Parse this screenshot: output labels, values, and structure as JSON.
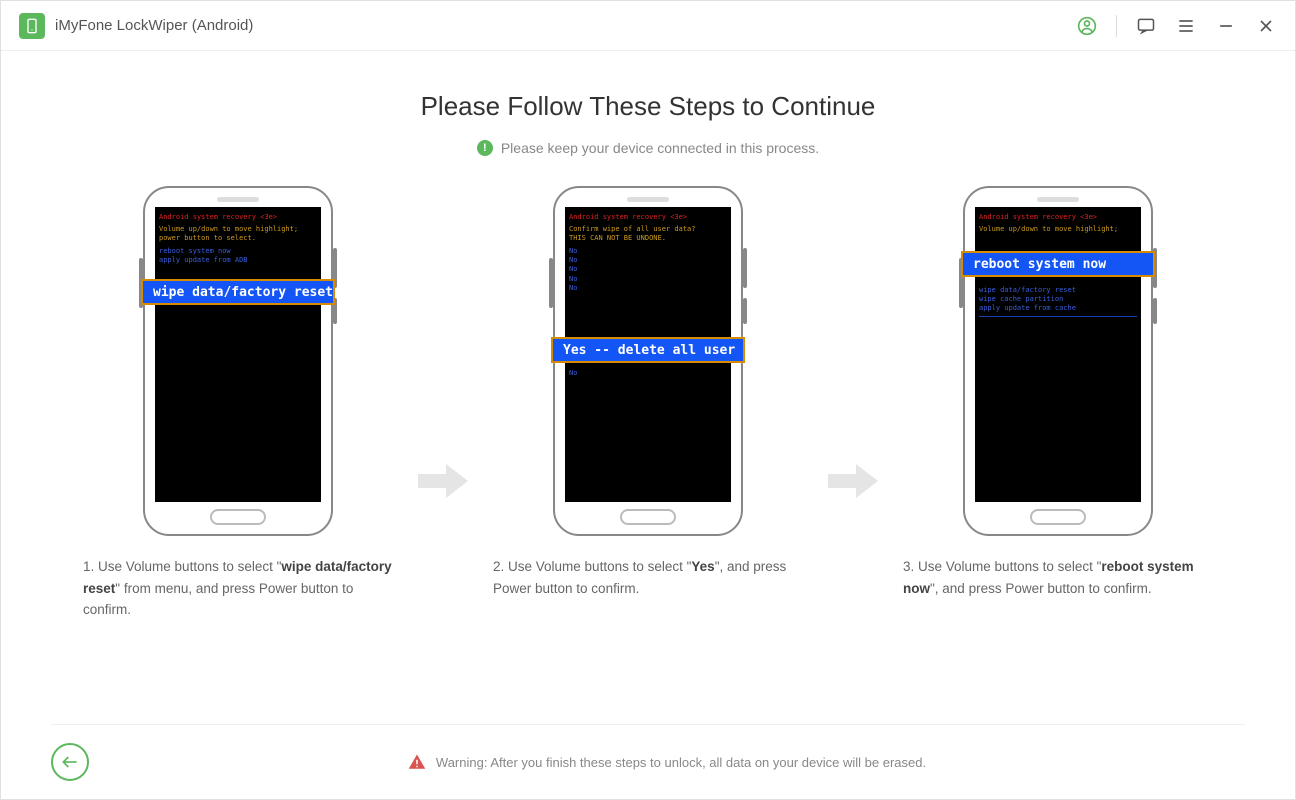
{
  "titlebar": {
    "title": "iMyFone LockWiper (Android)"
  },
  "main": {
    "title": "Please Follow These Steps to Continue",
    "subtitle": "Please keep your device connected in this process."
  },
  "steps": [
    {
      "highlight": "wipe data/factory reset",
      "text_pre": "1. Use Volume buttons to select \"",
      "text_bold": "wipe data/factory reset",
      "text_post": "\" from menu, and press Power button to confirm.",
      "rec_header": "Android system recovery <3e>",
      "rec_yellow": "Volume up/down to move highlight;\npower button to select.",
      "rec_blue": "reboot system now\napply update from ADB"
    },
    {
      "highlight": "Yes -- delete all user",
      "text_pre": "2. Use Volume buttons to select \"",
      "text_bold": "Yes",
      "text_post": "\", and press Power button to confirm.",
      "rec_header": "Android system recovery <3e>",
      "rec_yellow": "Confirm wipe of all user data?\n  THIS CAN NOT BE UNDONE.",
      "rec_blue": "No\nNo\nNo\nNo\nNo"
    },
    {
      "highlight": "reboot system now",
      "text_pre": "3. Use Volume buttons to select \"",
      "text_bold": "reboot system now",
      "text_post": "\", and press Power button to confirm.",
      "rec_header": "Android system recovery <3e>",
      "rec_yellow": "Volume up/down to move highlight;",
      "rec_blue": "wipe data/factory reset\nwipe cache partition\napply update from cache"
    }
  ],
  "footer": {
    "warning": "Warning: After you finish these steps to unlock, all data on your device will be erased."
  }
}
